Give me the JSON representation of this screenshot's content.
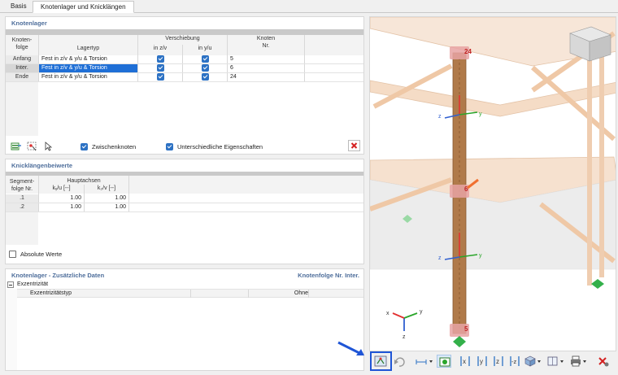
{
  "tabs": [
    {
      "label": "Basis"
    },
    {
      "label": "Knotenlager und Knicklängen"
    }
  ],
  "knotenlager": {
    "title": "Knotenlager",
    "headers": {
      "knotenfolge": "Knoten-\nfolge",
      "lagertyp": "Lagertyp",
      "verschiebung": "Verschiebung",
      "in_zv": "in z/v",
      "in_yu": "in y/u",
      "knoten_nr": "Knoten\nNr."
    },
    "rows": [
      {
        "folge": "Anfang",
        "typ": "Fest in z/v & y/u & Torsion",
        "knoten": "5"
      },
      {
        "folge": "Inter.",
        "typ": "Fest in z/v & y/u & Torsion",
        "knoten": "6"
      },
      {
        "folge": "Ende",
        "typ": "Fest in z/v & y/u & Torsion",
        "knoten": "24"
      }
    ],
    "zwischenknoten_label": "Zwischenknoten",
    "unterschiedliche_label": "Unterschiedliche Eigenschaften"
  },
  "knicklaengen": {
    "title": "Knicklängenbeiwerte",
    "headers": {
      "segment": "Segment-\nfolge Nr.",
      "hauptachsen": "Hauptachsen",
      "ky": "kᵧ/u [--]",
      "kz": "k₂/v [--]"
    },
    "rows": [
      {
        "nr": ".1",
        "ky": "1.00",
        "kz": "1.00"
      },
      {
        "nr": ".2",
        "ky": "1.00",
        "kz": "1.00"
      }
    ],
    "absolute_label": "Absolute Werte"
  },
  "zusatz": {
    "title": "Knotenlager - Zusätzliche Daten",
    "right_label": "Knotenfolge Nr. Inter.",
    "group": "Exzentrizität",
    "item_label": "Exzentrizitätstyp",
    "item_value": "Ohne"
  },
  "viewport": {
    "node_labels": [
      "24",
      "6",
      "5"
    ],
    "axis_labels": {
      "x": "x",
      "y": "y",
      "z": "z"
    }
  },
  "colors": {
    "accent": "#2d72c4",
    "timber": "#b07a4a",
    "timber_light": "#f3ddc9",
    "node_pink": "#e8a3a3",
    "support_green": "#33b04a",
    "axis_red": "#e23030",
    "axis_green": "#2aa52a",
    "axis_blue": "#2f5fd0",
    "highlight": "#1f6fd6"
  }
}
